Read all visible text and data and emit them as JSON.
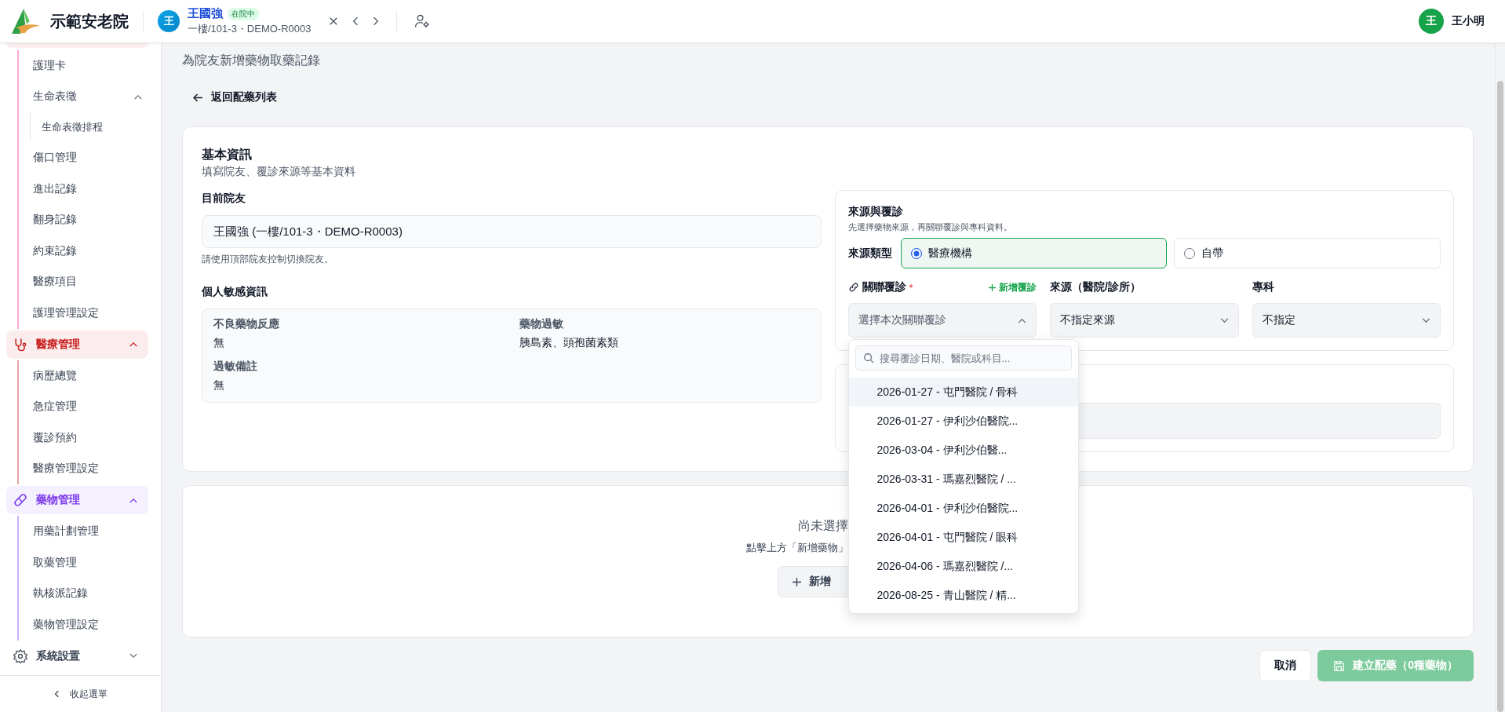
{
  "topbar": {
    "brand": "示範安老院",
    "patient": {
      "avatar": "王",
      "name": "王國強",
      "status": "在院中",
      "detail": "一樓/101-3・DEMO-R0003"
    },
    "user": {
      "avatar": "王",
      "name": "王小明"
    }
  },
  "sidebar": {
    "nursing_items": [
      {
        "label": "護理卡"
      },
      {
        "label": "生命表徵",
        "expanded": true,
        "children": [
          {
            "label": "生命表徵排程"
          }
        ]
      },
      {
        "label": "傷口管理"
      },
      {
        "label": "進出記錄"
      },
      {
        "label": "翻身記錄"
      },
      {
        "label": "約束記錄"
      },
      {
        "label": "醫療項目"
      },
      {
        "label": "護理管理設定"
      }
    ],
    "groups": [
      {
        "label": "醫療管理",
        "kind": "medical",
        "color": "#c81e1e",
        "expanded": true,
        "children": [
          {
            "label": "病歷總覽"
          },
          {
            "label": "急症管理"
          },
          {
            "label": "覆診預約"
          },
          {
            "label": "醫療管理設定"
          }
        ]
      },
      {
        "label": "藥物管理",
        "kind": "medication",
        "color": "#7c3aed",
        "expanded": true,
        "children": [
          {
            "label": "用藥計劃管理"
          },
          {
            "label": "取藥管理"
          },
          {
            "label": "執核派記錄"
          },
          {
            "label": "藥物管理設定"
          }
        ]
      },
      {
        "label": "系統設置",
        "kind": "settings",
        "expanded": false
      }
    ],
    "collapse_label": "收起選單"
  },
  "page": {
    "subtitle": "為院友新增藥物取藥記錄",
    "back_link": "返回配藥列表"
  },
  "basic_info": {
    "title": "基本資訊",
    "subtitle": "填寫院友、覆診來源等基本資料",
    "resident_label": "目前院友",
    "resident_value": "王國強 (一樓/101-3・DEMO-R0003)",
    "resident_hint": "請使用頂部院友控制切換院友。",
    "sensitive_title": "個人敏感資訊",
    "sensitive_items": [
      {
        "label": "不良藥物反應",
        "value": "無"
      },
      {
        "label": "藥物過敏",
        "value": "胰島素、頭孢菌素類"
      },
      {
        "label": "過敏備註",
        "value": "無"
      }
    ]
  },
  "source": {
    "title": "來源與覆診",
    "subtitle": "先選擇藥物來源，再關聯覆診與專科資料。",
    "type_label": "來源類型",
    "type_options": [
      {
        "label": "醫療機構",
        "selected": true
      },
      {
        "label": "自帶",
        "selected": false
      }
    ],
    "visit": {
      "label": "關聯覆診",
      "required_mark": "*",
      "add_label": "新增覆診",
      "placeholder": "選擇本次關聯覆診",
      "expanded": true
    },
    "hospital": {
      "label": "來源（醫院/診所）",
      "value": "不指定來源"
    },
    "specialty": {
      "label": "專科",
      "value": "不指定"
    },
    "dropdown": {
      "search_placeholder": "搜尋覆診日期、醫院或科目...",
      "options": [
        {
          "label": "2026-01-27 - 屯門醫院 / 骨科",
          "highlighted": true
        },
        {
          "label": "2026-01-27 - 伊利沙伯醫院...",
          "highlighted": false
        },
        {
          "label": "2026-03-04 - 伊利沙伯醫...",
          "highlighted": false
        },
        {
          "label": "2026-03-31 - 瑪嘉烈醫院 / ...",
          "highlighted": false
        },
        {
          "label": "2026-04-01 - 伊利沙伯醫院...",
          "highlighted": false
        },
        {
          "label": "2026-04-01 - 屯門醫院 / 眼科",
          "highlighted": false
        },
        {
          "label": "2026-04-06 - 瑪嘉烈醫院 /...",
          "highlighted": false
        },
        {
          "label": "2026-08-25 - 青山醫院 / 精...",
          "highlighted": false
        }
      ]
    }
  },
  "medicines": {
    "empty_title": "尚未選擇",
    "empty_hint": "點擊上方「新增藥物」",
    "add_button": "新增"
  },
  "actions": {
    "cancel": "取消",
    "submit": "建立配藥（0種藥物）",
    "submit_disabled": true
  }
}
